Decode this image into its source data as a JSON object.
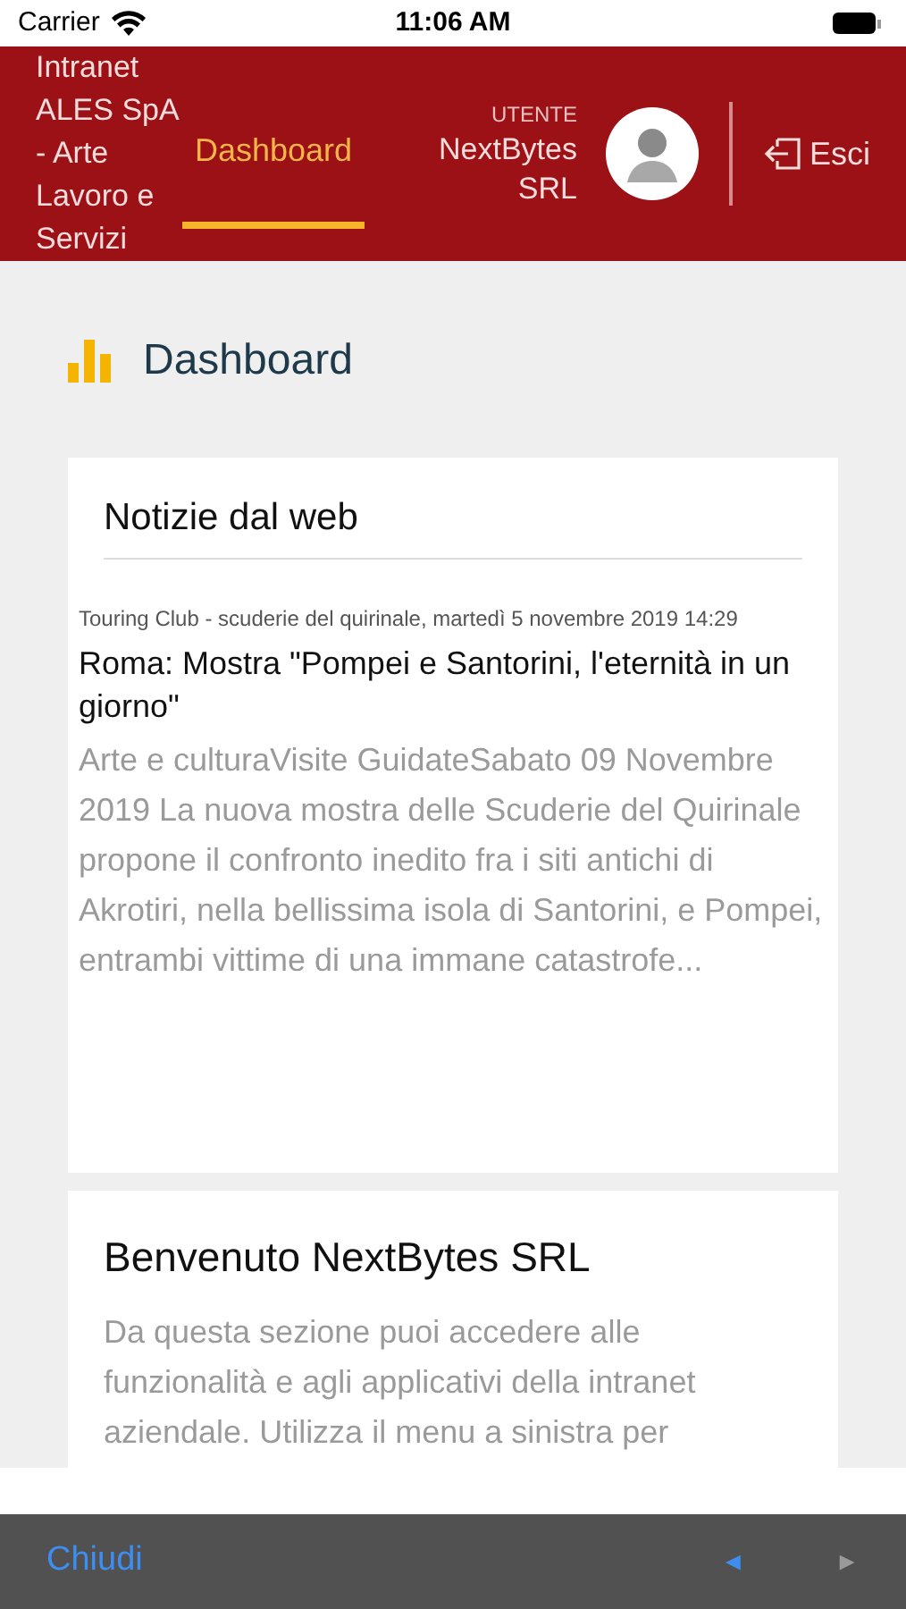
{
  "status_bar": {
    "carrier": "Carrier",
    "time": "11:06 AM"
  },
  "header": {
    "title": "Intranet ALES SpA - Arte Lavoro e Servizi",
    "tabs": [
      {
        "label": "Dashboard",
        "selected": true
      }
    ],
    "user_label": "UTENTE",
    "user_name": "NextBytes SRL",
    "logout": "Esci"
  },
  "page": {
    "title": "Dashboard"
  },
  "news_card": {
    "title": "Notizie dal web",
    "items": [
      {
        "source": "Touring Club - scuderie del quirinale,  martedì 5 novembre 2019 14:29",
        "headline": "Roma: Mostra \"Pompei e Santorini, l'eternità in un giorno\"",
        "summary": "Arte e culturaVisite GuidateSabato 09 Novembre 2019 La nuova mostra delle Scuderie del Quirinale propone il confronto inedito fra i siti antichi di Akrotiri, nella bellissima isola di Santorini, e Pompei, entrambi vittime di una immane catastrofe..."
      }
    ]
  },
  "welcome_card": {
    "title": "Benvenuto NextBytes SRL",
    "text": "Da questa sezione puoi accedere alle funzionalità e agli applicativi della intranet aziendale. Utilizza il menu a sinistra per"
  },
  "toolbar": {
    "close": "Chiudi",
    "back": {
      "label": "◄",
      "disabled": false
    },
    "forward": {
      "label": "►",
      "disabled": true
    }
  }
}
